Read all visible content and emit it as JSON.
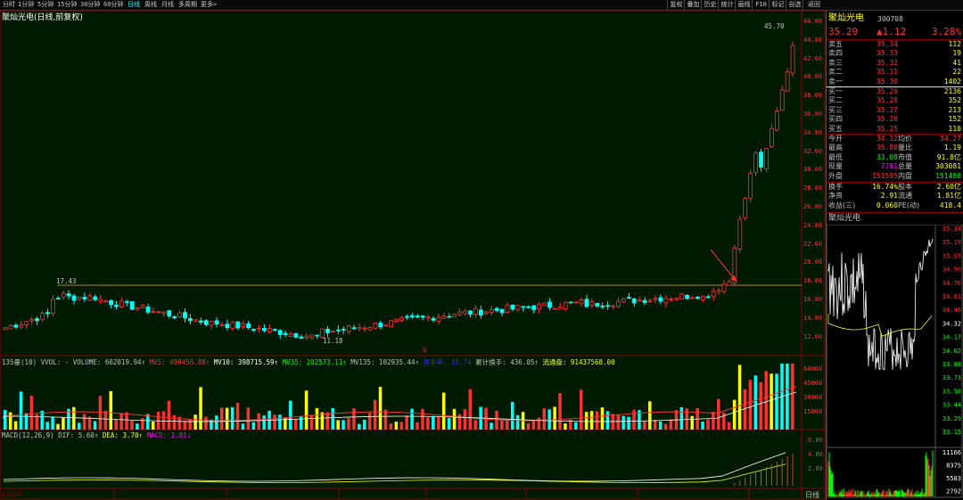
{
  "toolbar": {
    "periods": [
      "分时",
      "1分钟",
      "5分钟",
      "15分钟",
      "30分钟",
      "60分钟",
      "日线",
      "周线",
      "月线",
      "多周期",
      "更多>"
    ],
    "active_period": "日线",
    "tools": [
      "复权",
      "叠加",
      "历史",
      "统计",
      "画线",
      "F10",
      "标记",
      "自选",
      "返回"
    ]
  },
  "chart": {
    "stock_name": "聚灿光电",
    "title_suffix": "(日线,前复权)",
    "price_axis": [
      "46.00",
      "44.00",
      "42.00",
      "40.00",
      "38.00",
      "36.00",
      "34.00",
      "32.00",
      "30.00",
      "28.00",
      "26.00",
      "24.00",
      "22.00",
      "20.00",
      "18.00",
      "16.00",
      "14.00",
      "12.00"
    ],
    "annot_high": "45.70",
    "annot_low": "11.18",
    "annot_prev_high": "17.43",
    "volume_line": {
      "prefix": "135量(10) VVOL: - VOLUME: 602019.94↑",
      "mv5": "MV5: 499456.88↑",
      "mv10": "MV10: 398715.59↑",
      "mv35": "MV35: 202573.11↑",
      "mv135": "MV135: 102935.44↑",
      "blue_item": "换手率: 16.74",
      "cum_turnover": "累计换手: 436.05↑",
      "float_cap": "流通盘: 91437568.00"
    },
    "volume_axis": [
      "60000",
      "45000",
      "30000",
      "15000"
    ],
    "macd_line": {
      "prefix": "MACD(12,26,9) DIF: 5.60↑",
      "dea": "DEA: 3.70↑",
      "macd": "MACD: 3.81↓"
    },
    "macd_axis": [
      "6.00",
      "4.00",
      "2.00"
    ],
    "date_axis_label": "日线",
    "year_label": "2023年"
  },
  "quote": {
    "name": "聚灿光电",
    "code": "300708",
    "price": "35.29",
    "change": "▲1.12",
    "pct": "3.28%",
    "asks": [
      {
        "label": "卖五",
        "price": "35.34",
        "vol": "112"
      },
      {
        "label": "卖四",
        "price": "35.33",
        "vol": "19"
      },
      {
        "label": "卖三",
        "price": "35.32",
        "vol": "41"
      },
      {
        "label": "卖二",
        "price": "35.31",
        "vol": "22"
      },
      {
        "label": "卖一",
        "price": "35.30",
        "vol": "1402"
      }
    ],
    "bids": [
      {
        "label": "买一",
        "price": "35.29",
        "vol": "2136"
      },
      {
        "label": "买二",
        "price": "35.28",
        "vol": "352"
      },
      {
        "label": "买三",
        "price": "35.27",
        "vol": "213"
      },
      {
        "label": "买四",
        "price": "35.26",
        "vol": "152"
      },
      {
        "label": "买五",
        "price": "35.25",
        "vol": "110"
      }
    ],
    "stats": [
      {
        "l1": "今开",
        "v1": "34.12",
        "l2": "均价",
        "v2": "34.27"
      },
      {
        "l1": "最高",
        "v1": "35.80",
        "l2": "量比",
        "v2": "1.19"
      },
      {
        "l1": "最低",
        "v1": "33.08",
        "l2": "市值",
        "v2": "91.8亿"
      },
      {
        "l1": "现量",
        "v1": "7791",
        "l2": "总量",
        "v2": "303081"
      },
      {
        "l1": "外盘",
        "v1": "151595",
        "l2": "内盘",
        "v2": "151486"
      }
    ],
    "stats2": [
      {
        "l1": "换手",
        "v1": "16.74%",
        "l2": "股本",
        "v2": "2.60亿"
      },
      {
        "l1": "净资",
        "v1": "2.91",
        "l2": "流通",
        "v2": "1.81亿"
      },
      {
        "l1": "收益(三)",
        "v1": "0.060",
        "l2": "PE(动)",
        "v2": "418.4"
      }
    ],
    "intraday_title": "聚灿光电",
    "intraday_axis": [
      "35.34",
      "35.19",
      "35.05",
      "34.90",
      "34.76",
      "34.61",
      "34.46",
      "34.32",
      "34.17",
      "34.02",
      "33.88",
      "33.73",
      "33.58",
      "33.44",
      "33.29",
      "33.15"
    ],
    "intraday_vol_axis": [
      "11166",
      "8375",
      "5583",
      "2792"
    ]
  }
}
